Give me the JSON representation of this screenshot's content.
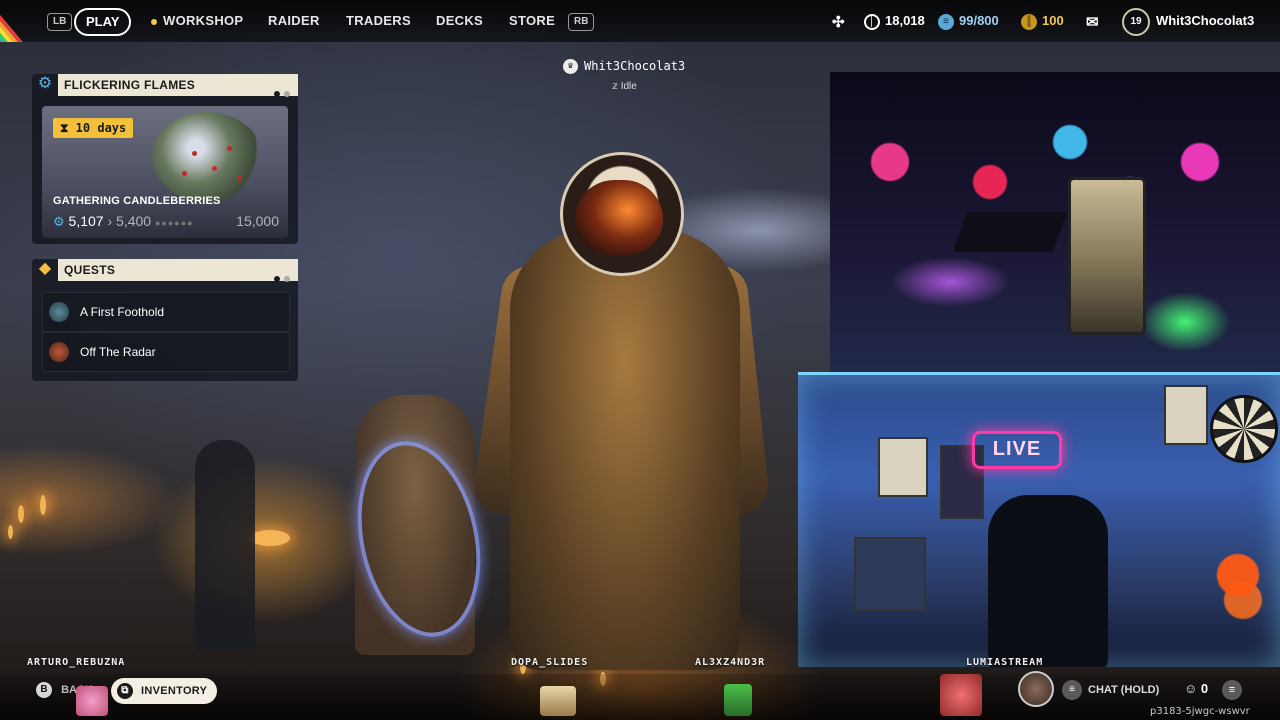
{
  "topbar": {
    "lb": "LB",
    "rb": "RB",
    "nav": [
      {
        "label": "PLAY"
      },
      {
        "label": "WORKSHOP"
      },
      {
        "label": "RAIDER"
      },
      {
        "label": "TRADERS"
      },
      {
        "label": "DECKS"
      },
      {
        "label": "STORE"
      }
    ],
    "coins": "18,018",
    "storage": "99/800",
    "raider_tokens": "100",
    "level": "19",
    "username": "Whit3Chocolat3"
  },
  "event_panel": {
    "title": "FLICKERING FLAMES",
    "timer": "10 days",
    "card_title": "GATHERING CANDLEBERRIES",
    "progress_current": "5,107",
    "progress_next": "5,400",
    "progress_max": "15,000"
  },
  "quests_panel": {
    "title": "QUESTS",
    "items": [
      {
        "label": "A First Foothold"
      },
      {
        "label": "Off The Radar"
      }
    ]
  },
  "player_tag": {
    "name": "Whit3Chocolat3",
    "status": "Idle"
  },
  "player_names": [
    "ARTURO_REBUZNA",
    "DOPA_SLIDES",
    "AL3XZ4ND3R",
    "LUMIASTREAM"
  ],
  "webcam": {
    "live_sign": "LIVE"
  },
  "bottombar": {
    "back_key": "B",
    "back_label": "BACK",
    "inventory_label": "INVENTORY",
    "chat_label": "CHAT (HOLD)",
    "party_count": "0",
    "session_id": "p3183-5jwgc-wswvr"
  }
}
